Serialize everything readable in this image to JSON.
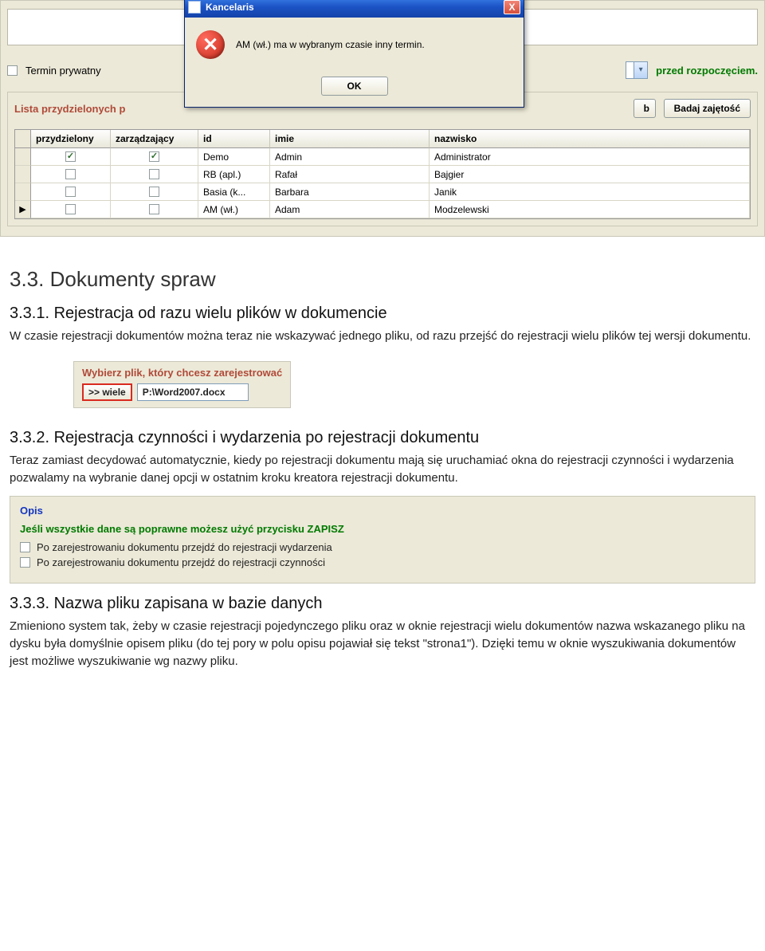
{
  "dialog": {
    "title": "Kancelaris",
    "message": "AM (wł.) ma w wybranym czasie inny termin.",
    "ok": "OK",
    "close_label": "X"
  },
  "top": {
    "private_term_label": "Termin prywatny",
    "before_start_label": "przed rozpoczęciem."
  },
  "panel": {
    "title": "Lista przydzielonych p",
    "b_label": "b",
    "check_busy_label": "Badaj zajętość",
    "columns": {
      "przydzielony": "przydzielony",
      "zarzadzajacy": "zarządzający",
      "id": "id",
      "imie": "imie",
      "nazwisko": "nazwisko"
    },
    "rows": [
      {
        "przydzielony": true,
        "zarzadzajacy": true,
        "id": "Demo",
        "imie": "Admin",
        "nazwisko": "Administrator",
        "marker": ""
      },
      {
        "przydzielony": false,
        "zarzadzajacy": false,
        "id": "RB (apl.)",
        "imie": "Rafał",
        "nazwisko": "Bajgier",
        "marker": ""
      },
      {
        "przydzielony": false,
        "zarzadzajacy": false,
        "id": "Basia (k...",
        "imie": "Barbara",
        "nazwisko": "Janik",
        "marker": ""
      },
      {
        "przydzielony": false,
        "zarzadzajacy": false,
        "id": "AM (wł.)",
        "imie": "Adam",
        "nazwisko": "Modzelewski",
        "marker": "▶"
      }
    ]
  },
  "doc": {
    "h_33": "3.3. Dokumenty spraw",
    "h_331": "3.3.1. Rejestracja od razu wielu plików w dokumencie",
    "p_331": "W czasie rejestracji dokumentów można teraz nie wskazywać jednego pliku, od razu przejść do rejestracji wielu plików tej wersji dokumentu.",
    "mini_reg_title": "Wybierz plik, który chcesz zarejestrować",
    "wiele_btn": ">> wiele",
    "path_value": "P:\\Word2007.docx",
    "h_332": "3.3.2. Rejestracja czynności i wydarzenia po rejestracji dokumentu",
    "p_332": "Teraz zamiast decydować automatycznie, kiedy po rejestracji dokumentu mają się uruchamiać okna do rejestracji czynności i wydarzenia pozwalamy na wybranie danej opcji w ostatnim kroku kreatora rejestracji dokumentu.",
    "opis_title": "Opis",
    "zapisz_line": "Jeśli wszystkie dane są poprawne możesz użyć przycisku ZAPISZ",
    "opis_check1": "Po zarejestrowaniu dokumentu przejdź do rejestracji wydarzenia",
    "opis_check2": "Po zarejestrowaniu dokumentu przejdź do rejestracji czynności",
    "h_333": "3.3.3. Nazwa pliku zapisana w bazie danych",
    "p_333": "Zmieniono system tak, żeby w czasie rejestracji pojedynczego pliku oraz w oknie rejestracji wielu dokumentów nazwa wskazanego pliku na dysku była domyślnie opisem pliku (do tej pory w polu opisu pojawiał się tekst \"strona1\"). Dzięki temu w oknie wyszukiwania dokumentów jest możliwe wyszukiwanie wg nazwy pliku."
  }
}
